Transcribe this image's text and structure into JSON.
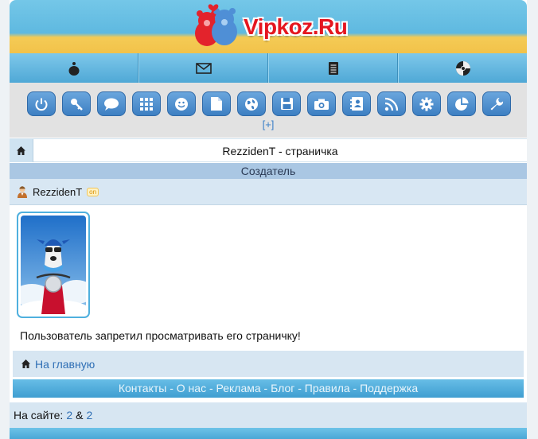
{
  "site": {
    "logo_text": "Vipkoz.Ru"
  },
  "topnav": [
    {
      "icon": "user-icon"
    },
    {
      "icon": "mail-icon"
    },
    {
      "icon": "notebook-icon"
    },
    {
      "icon": "disc-icon"
    }
  ],
  "iconbar": {
    "icons": [
      "power-icon",
      "key-icon",
      "chat-icon",
      "grid-icon",
      "smiley-icon",
      "document-icon",
      "globe-icon",
      "floppy-icon",
      "camera-icon",
      "contacts-icon",
      "rss-icon",
      "gear-icon",
      "pie-chart-icon",
      "wrench-icon"
    ],
    "expand_label": "[+]"
  },
  "page": {
    "title": "RezzidenT - страничка",
    "section_header": "Создатель",
    "user_name": "RezzidenT",
    "online_badge": "on",
    "message": "Пользователь запретил просматривать его страничку!",
    "home_link": "На главную"
  },
  "footer": {
    "links": "Контакты - О нас - Реклама - Блог - Правила - Поддержка",
    "online_label": "На сайте:",
    "online_a": "2",
    "online_sep": "&",
    "online_b": "2"
  },
  "colors": {
    "header_blue": "#5fb9e0",
    "header_yellow": "#f2c24a",
    "button_blue": "#3d7fc2",
    "link_blue": "#2f6fb5",
    "logo_red": "#e4161f"
  }
}
